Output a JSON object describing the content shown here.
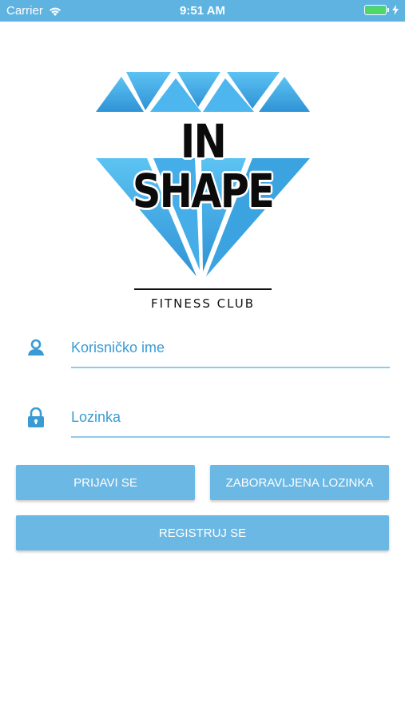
{
  "status_bar": {
    "carrier": "Carrier",
    "time": "9:51 AM",
    "battery_level": 1.0,
    "background_color": "#5fb3e0",
    "battery_color": "#4cd964"
  },
  "logo": {
    "title": "IN SHAPE",
    "subtitle": "FITNESS CLUB",
    "diamond_color": "#3aa3e0"
  },
  "form": {
    "username": {
      "placeholder": "Korisničko ime",
      "value": "",
      "icon": "user-icon"
    },
    "password": {
      "placeholder": "Lozinka",
      "value": "",
      "icon": "lock-icon"
    }
  },
  "buttons": {
    "login": "PRIJAVI SE",
    "forgot": "ZABORAVLJENA LOZINKA",
    "register": "REGISTRUJ SE",
    "color": "#6cb8e4"
  }
}
